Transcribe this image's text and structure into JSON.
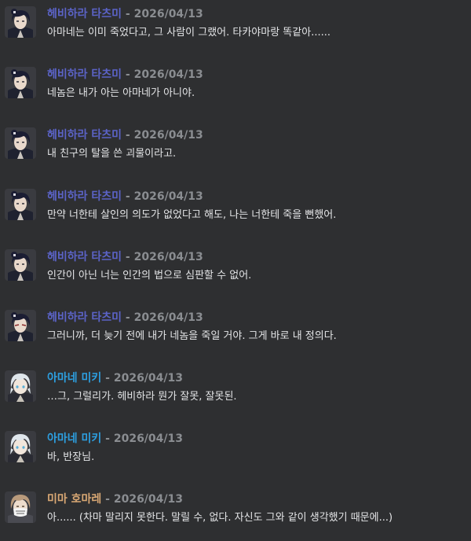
{
  "messages": [
    {
      "author": "헤비하라 타츠미",
      "sep": " - ",
      "date": "2026/04/13",
      "text": "아마네는 이미 죽었다고, 그 사람이 그랬어. 타카야마랑 똑같아......",
      "color": "#5b63c7",
      "avatar": "dark-hair-avatar"
    },
    {
      "author": "헤비하라 타츠미",
      "sep": " - ",
      "date": "2026/04/13",
      "text": "네놈은 내가 아는 아마네가 아니야.",
      "color": "#5b63c7",
      "avatar": "dark-hair-avatar"
    },
    {
      "author": "헤비하라 타츠미",
      "sep": " - ",
      "date": "2026/04/13",
      "text": "내 친구의 탈을 쓴 괴물이라고.",
      "color": "#5b63c7",
      "avatar": "dark-hair-avatar"
    },
    {
      "author": "헤비하라 타츠미",
      "sep": " - ",
      "date": "2026/04/13",
      "text": "만약 너한테 살인의 의도가 없었다고 해도, 나는 너한테 죽을 뻔했어.",
      "color": "#5b63c7",
      "avatar": "dark-hair-avatar"
    },
    {
      "author": "헤비하라 타츠미",
      "sep": " - ",
      "date": "2026/04/13",
      "text": "인간이 아닌 너는 인간의 법으로 심판할 수 없어.",
      "color": "#5b63c7",
      "avatar": "dark-hair-avatar"
    },
    {
      "author": "헤비하라 타츠미",
      "sep": " - ",
      "date": "2026/04/13",
      "text": "그러니까, 더 늦기 전에 내가 네놈을 죽일 거야. 그게 바로 내 정의다.",
      "color": "#5b63c7",
      "avatar": "dark-hair-avatar"
    },
    {
      "author": "아마네 미키",
      "sep": " - ",
      "date": "2026/04/13",
      "text": "…그, 그럴리가. 헤비하라 뭔가 잘못, 잘못된.",
      "color": "#2d9fe0",
      "avatar": "white-hair-avatar"
    },
    {
      "author": "아마네 미키",
      "sep": " - ",
      "date": "2026/04/13",
      "text": "바, 반장님.",
      "color": "#2d9fe0",
      "avatar": "white-hair-avatar"
    },
    {
      "author": "미마 호마레",
      "sep": " - ",
      "date": "2026/04/13",
      "text": "아...... (차마 말리지 못한다. 말릴 수, 없다. 자신도 그와 같이 생각했기 때문에...)",
      "color": "#d9a874",
      "avatar": "brown-hair-masked-avatar"
    }
  ]
}
